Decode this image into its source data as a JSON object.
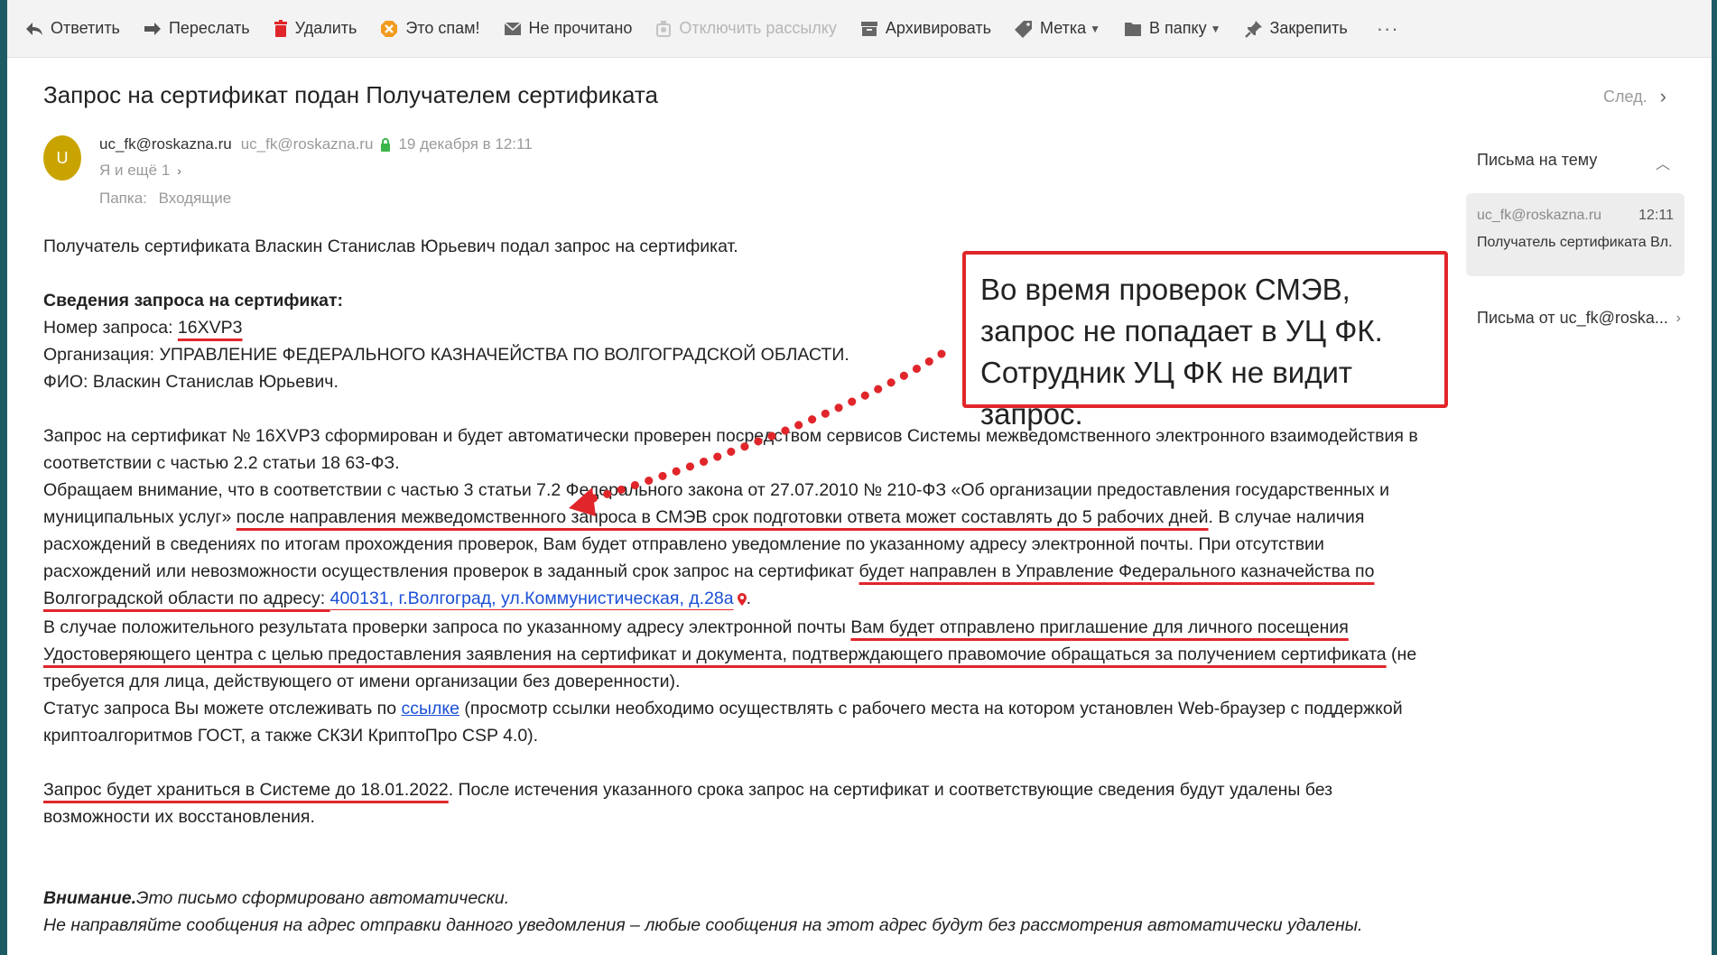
{
  "toolbar": {
    "reply": "Ответить",
    "forward": "Переслать",
    "delete": "Удалить",
    "spam": "Это спам!",
    "unread": "Не прочитано",
    "unsubscribe": "Отключить рассылку",
    "archive": "Архивировать",
    "label": "Метка",
    "to_folder": "В папку",
    "pin": "Закрепить",
    "more": "···"
  },
  "email": {
    "subject": "Запрос на сертификат подан Получателем сертификата",
    "next": "След.",
    "avatar_letter": "U",
    "sender_name": "uc_fk@roskazna.ru",
    "sender_email": "uc_fk@roskazna.ru",
    "date": "19 декабря в 12:11",
    "recipients": "Я и ещё 1",
    "folder_label": "Папка:",
    "folder_name": "Входящие"
  },
  "body": {
    "p1": "Получатель сертификата Власкин Станислав Юрьевич подал запрос на сертификат.",
    "details_title": "Сведения запроса на сертификат:",
    "req_label": "Номер запроса: ",
    "req_number": "16XVP3",
    "org": "Организация: УПРАВЛЕНИЕ ФЕДЕРАЛЬНОГО КАЗНАЧЕЙСТВА ПО ВОЛГОГРАДСКОЙ ОБЛАСТИ.",
    "fio": "ФИО: Власкин Станислав Юрьевич.",
    "p2": "Запрос на сертификат № 16XVP3 сформирован и будет автоматически проверен посредством сервисов Системы межведомственного электронного взаимодействия в соответствии с частью 2.2 статьи 18 63-ФЗ.",
    "p3a": "Обращаем внимание, что в соответствии с частью 3 статьи 7.2 Федерального закона от 27.07.2010 № 210-ФЗ «Об организации предоставления государственных и муниципальных услуг» ",
    "p3u": "после направления межведомственного запроса в СМЭВ срок подготовки ответа может составлять до 5 рабочих дней",
    "p3b": ". В случае наличия расхождений в сведениях по итогам прохождения проверок, Вам будет отправлено уведомление по указанному адресу электронной почты. При отсутствии расхождений или невозможности осуществления проверок в заданный срок запрос на сертификат ",
    "p3u2": "будет направлен в Управление Федерального казначейства по Волгоградской области по адресу: ",
    "p3link": "400131, г.Волгоград, ул.Коммунистическая, д.28а",
    "p3end": ".",
    "p4a": "В случае положительного результата проверки запроса по указанному адресу электронной почты ",
    "p4u": "Вам будет отправлено приглашение для личного посещения Удостоверяющего центра с целью предоставления заявления на сертификат и документа, подтверждающего правомочие обращаться за получением сертификата",
    "p4b": " (не требуется для лица, действующего от имени организации без доверенности).",
    "p5a": "Статус запроса Вы можете отслеживать по ",
    "p5link": "ссылке",
    "p5b": " (просмотр ссылки необходимо осуществлять с рабочего места на котором установлен Web-браузер с поддержкой криптоалгоритмов ГОСТ, а также СКЗИ КриптоПро CSP 4.0).",
    "p6u": "Запрос будет храниться в Системе до 18.01.2022",
    "p6b": ". После истечения указанного срока запрос на сертификат и соответствующие сведения будут удалены без возможности их восстановления.",
    "attn_bold": "Внимание.",
    "attn_text": "Это письмо сформировано автоматически.",
    "attn_line2": "Не направляйте сообщения на адрес отправки данного уведомления – любые сообщения на этот адрес будут без рассмотрения автоматически удалены."
  },
  "callout": {
    "text": "Во время проверок СМЭВ, запрос не попадает в УЦ ФК. Сотрудник УЦ ФК не видит запрос."
  },
  "right_panel": {
    "thread_title": "Письма на тему",
    "card_from": "uc_fk@roskazna.ru",
    "card_time": "12:11",
    "card_preview": "Получатель сертификата Вл...",
    "from_link": "Письма от uc_fk@roska..."
  },
  "colors": {
    "annotation": "#e0262a",
    "link": "#1a4fd6",
    "avatar": "#c9a400",
    "lock": "#3bb54a"
  }
}
